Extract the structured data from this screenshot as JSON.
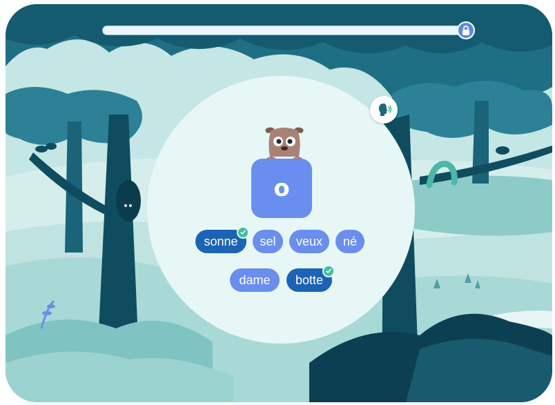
{
  "progress": {
    "value": 0.97
  },
  "target_sound": "o",
  "words": [
    {
      "text": "sonne",
      "selected": true
    },
    {
      "text": "sel",
      "selected": false
    },
    {
      "text": "veux",
      "selected": false
    },
    {
      "text": "né",
      "selected": false
    },
    {
      "text": "dame",
      "selected": false
    },
    {
      "text": "botte",
      "selected": true
    }
  ],
  "icons": {
    "progress_end": "lock-icon",
    "audio": "speaking-head-icon",
    "mascot": "dog-mascot-icon",
    "selected_mark": "checkmark-icon"
  },
  "colors": {
    "tile": "#6a8df0",
    "word_chip": "#6a8df0",
    "word_chip_selected": "#1b63b6",
    "check": "#3fbf9b",
    "panel": "#e6f7f6"
  }
}
